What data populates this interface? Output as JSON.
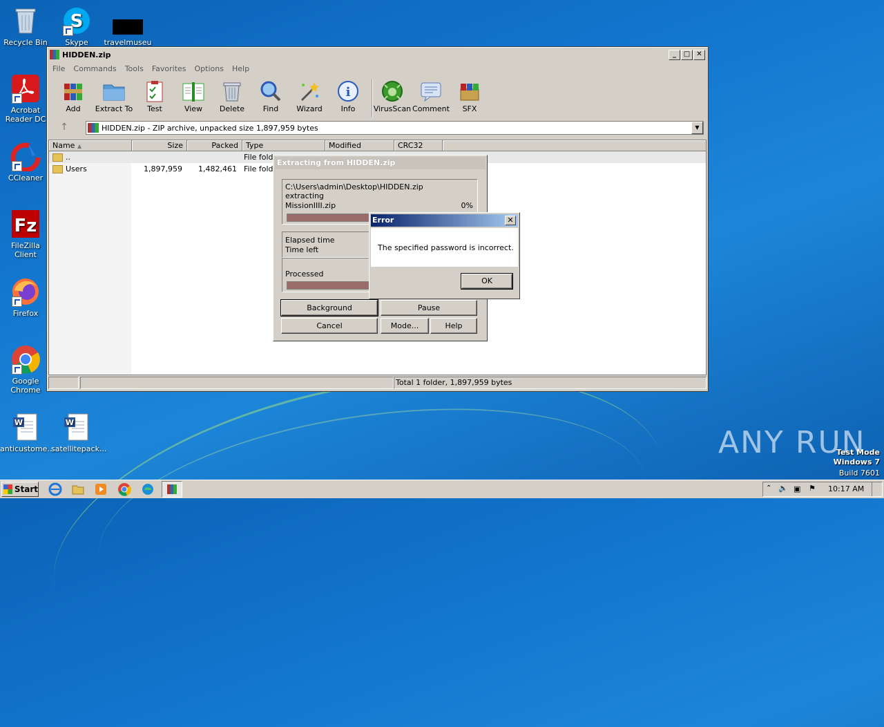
{
  "desktop": {
    "icons": [
      {
        "label": "Recycle Bin"
      },
      {
        "label": "Skype"
      },
      {
        "label": "travelmuseu"
      },
      {
        "label": "Acrobat Reader DC"
      },
      {
        "label": "CCleaner"
      },
      {
        "label": "FileZilla Client"
      },
      {
        "label": "Firefox"
      },
      {
        "label": "Google Chrome"
      },
      {
        "label": "anticustome..."
      },
      {
        "label": "satellitepack..."
      }
    ],
    "watermark": "ANY RUN",
    "test_mode": {
      "line1": "Test Mode",
      "line2": "Windows 7",
      "line3": "Build 7601"
    }
  },
  "window": {
    "title": "HIDDEN.zip",
    "menu": [
      "File",
      "Commands",
      "Tools",
      "Favorites",
      "Options",
      "Help"
    ],
    "toolbar": [
      {
        "label": "Add",
        "icon": "add-icon"
      },
      {
        "label": "Extract To",
        "icon": "extract-to-icon"
      },
      {
        "label": "Test",
        "icon": "test-icon"
      },
      {
        "label": "View",
        "icon": "view-icon"
      },
      {
        "label": "Delete",
        "icon": "delete-icon"
      },
      {
        "label": "Find",
        "icon": "find-icon"
      },
      {
        "label": "Wizard",
        "icon": "wizard-icon"
      },
      {
        "label": "Info",
        "icon": "info-icon"
      },
      {
        "label": "VirusScan",
        "icon": "virusscan-icon"
      },
      {
        "label": "Comment",
        "icon": "comment-icon"
      },
      {
        "label": "SFX",
        "icon": "sfx-icon"
      }
    ],
    "address": "HIDDEN.zip - ZIP archive, unpacked size 1,897,959 bytes",
    "columns": [
      "Name",
      "Size",
      "Packed",
      "Type",
      "Modified",
      "CRC32"
    ],
    "rows": [
      {
        "name": "..",
        "size": "",
        "packed": "",
        "type": "File fold"
      },
      {
        "name": "Users",
        "size": "1,897,959",
        "packed": "1,482,461",
        "type": "File fold"
      }
    ],
    "status": "Total 1 folder, 1,897,959 bytes"
  },
  "extracting": {
    "title": "Extracting from HIDDEN.zip",
    "path": "C:\\Users\\admin\\Desktop\\HIDDEN.zip",
    "action": "extracting",
    "file": "MissionIIII.zip",
    "percent": "0%",
    "elapsed_label": "Elapsed time",
    "left_label": "Time left",
    "processed_label": "Processed",
    "buttons": {
      "background": "Background",
      "pause": "Pause",
      "cancel": "Cancel",
      "mode": "Mode...",
      "help": "Help"
    }
  },
  "error": {
    "title": "Error",
    "message": "The specified password is incorrect.",
    "ok": "OK"
  },
  "taskbar": {
    "start": "Start",
    "time": "10:17 AM"
  }
}
